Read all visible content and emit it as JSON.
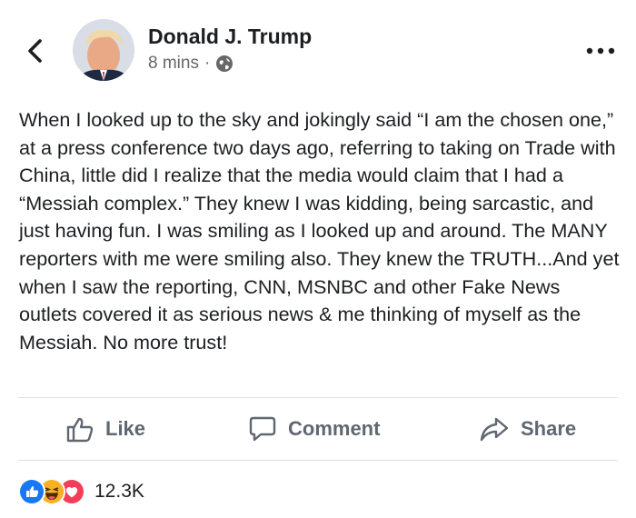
{
  "author": {
    "name": "Donald J. Trump",
    "time": "8 mins",
    "separator": "·",
    "privacy_icon": "globe-icon"
  },
  "post": {
    "text": "When I looked up to the sky and jokingly said “I am the chosen one,” at a press conference two days ago, referring to taking on Trade with China, little did I realize that the media would claim that I had a “Messiah complex.” They knew I was kidding, being sarcastic, and just having fun. I was smiling as I looked up and around. The MANY reporters with me were smiling also. They knew the TRUTH...And yet when I saw the reporting, CNN, MSNBC and other Fake News outlets covered it as serious news & me thinking of myself as the Messiah. No more trust!"
  },
  "actions": {
    "like": "Like",
    "comment": "Comment",
    "share": "Share"
  },
  "reactions": {
    "icons": [
      "like-icon",
      "haha-icon",
      "love-icon"
    ],
    "count": "12.3K"
  },
  "colors": {
    "like_blue": "#1877f2",
    "love_red": "#f33e58",
    "haha_yellow": "#f7b125",
    "muted": "#606770"
  }
}
